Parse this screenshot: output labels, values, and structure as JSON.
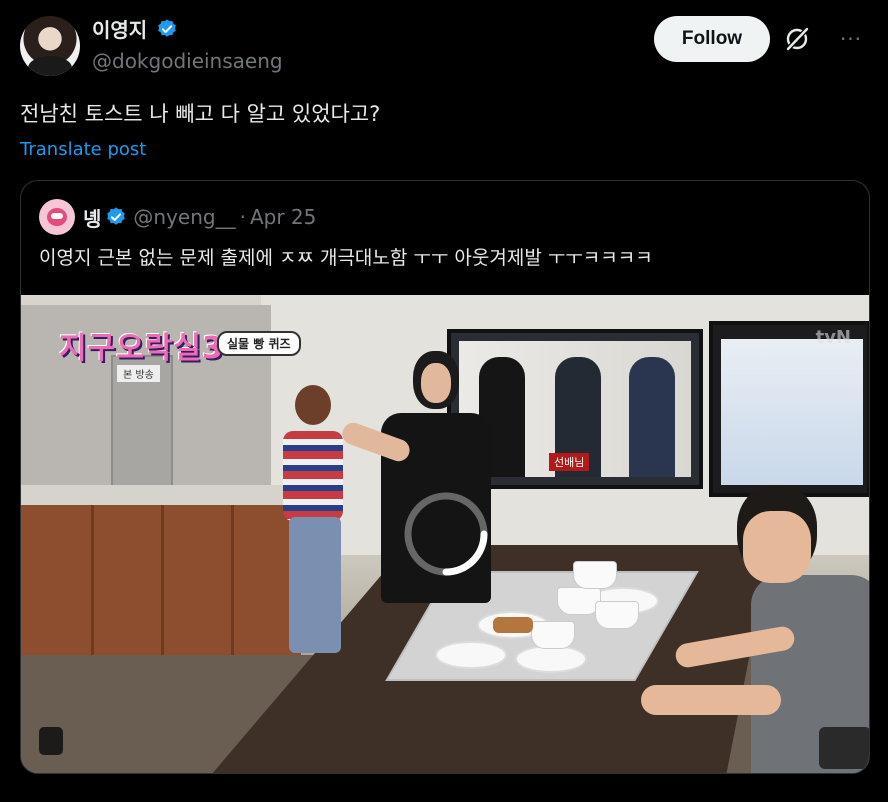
{
  "post": {
    "display_name": "이영지",
    "handle": "@dokgodieinsaeng",
    "follow_label": "Follow",
    "more_label": "···",
    "text": "전남친 토스트 나 빼고 다 알고 있었다고?",
    "translate_label": "Translate post"
  },
  "quoted": {
    "display_name": "녱",
    "handle": "@nyeng__",
    "separator": "·",
    "date": "Apr 25",
    "text": "이영지 근본 없는 문제 출제에 ㅈㅉ 개극대노함 ㅜㅜ 아웃겨제발 ㅜㅜㅋㅋㅋㅋ",
    "media": {
      "show_title": "지구오락실3",
      "badge": "실물 빵 퀴즈",
      "sign": "본 방송",
      "tv_label": "선배님",
      "channel": "tvN"
    }
  },
  "colors": {
    "background": "#000000",
    "text": "#e7e9ea",
    "secondary": "#71767b",
    "link": "#1d9bf0",
    "follow_bg": "#eff3f4",
    "verified": "#1d9bf0"
  },
  "icons": [
    "verified-badge-icon",
    "grok-icon",
    "more-icon",
    "loading-spinner-icon"
  ]
}
